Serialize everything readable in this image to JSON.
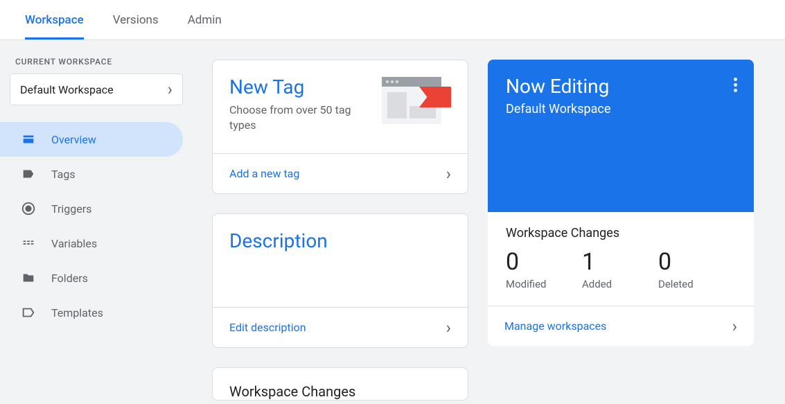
{
  "tabs": {
    "workspace": "Workspace",
    "versions": "Versions",
    "admin": "Admin"
  },
  "sidebar": {
    "current_label": "CURRENT WORKSPACE",
    "workspace_name": "Default Workspace",
    "items": {
      "overview": "Overview",
      "tags": "Tags",
      "triggers": "Triggers",
      "variables": "Variables",
      "folders": "Folders",
      "templates": "Templates"
    }
  },
  "new_tag": {
    "title": "New Tag",
    "subtitle": "Choose from over 50 tag types",
    "action": "Add a new tag"
  },
  "description": {
    "title": "Description",
    "action": "Edit description"
  },
  "now_editing": {
    "title": "Now Editing",
    "workspace": "Default Workspace",
    "changes_title": "Workspace Changes",
    "stats": {
      "modified_n": "0",
      "modified_l": "Modified",
      "added_n": "1",
      "added_l": "Added",
      "deleted_n": "0",
      "deleted_l": "Deleted"
    },
    "action": "Manage workspaces"
  },
  "workspace_changes": {
    "title": "Workspace Changes"
  }
}
